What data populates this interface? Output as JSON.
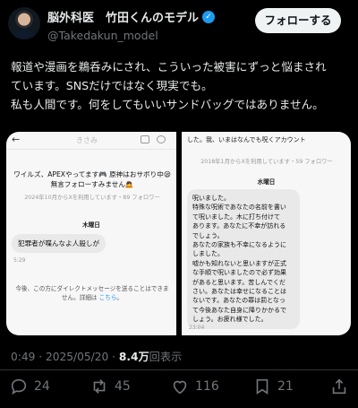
{
  "author": {
    "display_name": "脳外科医　竹田くんのモデル",
    "handle": "@Takedakun_model",
    "verified": true,
    "follow_label": "フォローする"
  },
  "tweet": {
    "text_lines": [
      "報道や漫画を鵜呑みにされ、こういった被害にずっと悩まされ",
      "ています。SNSだけではなく現実でも。",
      "私も人間です。何をしてもいいサンドバッグではありません。"
    ],
    "time": "0:49 · 2025/05/20 · ",
    "views_count": "8.4万",
    "views_label": "回表示"
  },
  "left_screenshot": {
    "header_name": "きさみ",
    "bio": "ワイルズ、APEXやってます🎮 原神はおサボり中😪 無言フォローすみません🙇",
    "account_meta": "2024年10月からXを利用しています・89 フォロワー",
    "day_label": "木曜日",
    "message": "犯罪者が喋んなよ人殺しが",
    "message_time": "5:29",
    "notice_text": "今後、この方にダイレクトメッセージを送ることはできません。詳細は",
    "notice_link": "こちら",
    "notice_end": "。"
  },
  "right_screenshot": {
    "bio_lines": [
      "した。我、いまはなんでも呪くアカウント"
    ],
    "account_meta": "2018年1月からXを利用しています・59 フォロワー",
    "day_label": "水曜日",
    "message_lines": [
      "呪いました。",
      "特殊な呪術であなたの名前を書い",
      "て呪いました。木に打ち付けて",
      "あります。あなたに不幸が訪れる",
      "でしょう。",
      "あなたの家族も不幸になるように",
      "しました。",
      "嘘かも知れないと思いますが正式",
      "な手順で呪いましたので必ず効果",
      "があると思います。苦しんでくだ",
      "さい。あなたは幸せになることは",
      "ないです。あなたの罪は罰となっ",
      "て今後あなた自身に降りかかるで",
      "しょう。お疲れ様でした。"
    ],
    "message_time": "23:04"
  },
  "actions": {
    "reply_count": "24",
    "retweet_count": "45",
    "like_count": "116",
    "bookmark_count": "21"
  }
}
